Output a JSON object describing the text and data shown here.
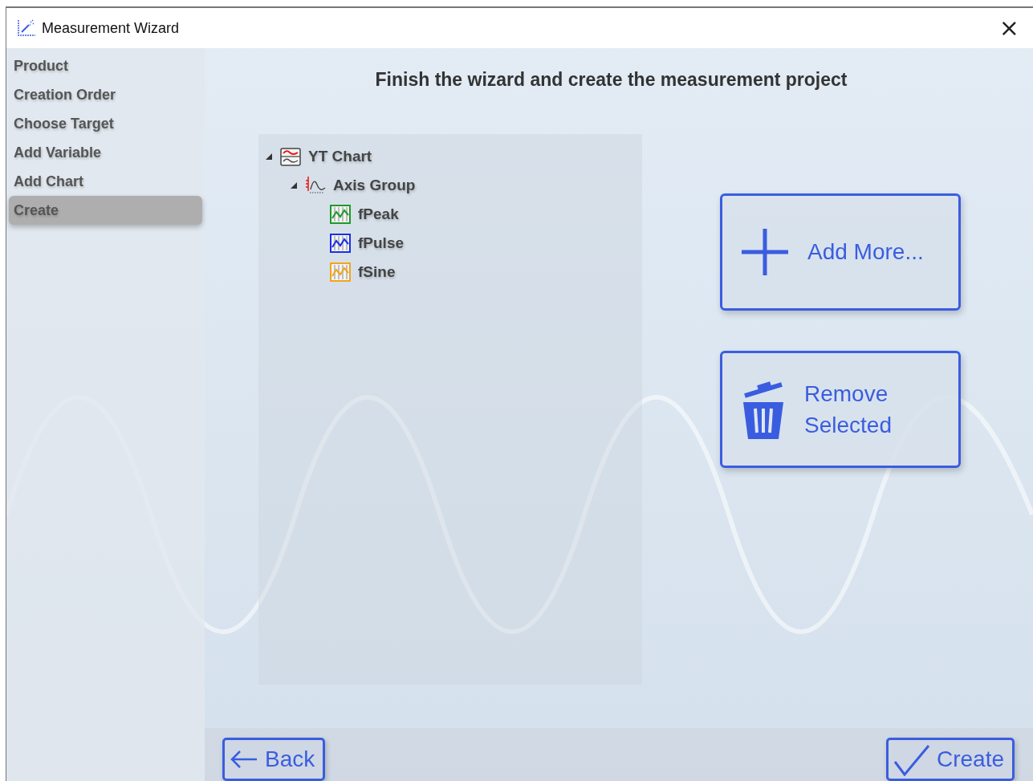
{
  "window": {
    "title": "Measurement Wizard",
    "close": "×"
  },
  "steps": [
    {
      "label": "Product",
      "selected": false
    },
    {
      "label": "Creation Order",
      "selected": false
    },
    {
      "label": "Choose Target",
      "selected": false
    },
    {
      "label": "Add Variable",
      "selected": false
    },
    {
      "label": "Add Chart",
      "selected": false
    },
    {
      "label": "Create",
      "selected": true
    }
  ],
  "heading": "Finish the wizard and create the measurement project",
  "tree": [
    {
      "label": "YT Chart",
      "kind": "chart",
      "expanded": true,
      "children": [
        {
          "label": "Axis Group",
          "kind": "axis-group",
          "expanded": true,
          "children": [
            {
              "label": "fPeak",
              "kind": "variable",
              "color": "#1e9a2a"
            },
            {
              "label": "fPulse",
              "kind": "variable",
              "color": "#1a2ee8"
            },
            {
              "label": "fSine",
              "kind": "variable",
              "color": "#f2a51a"
            }
          ]
        }
      ]
    }
  ],
  "actions": [
    {
      "label": "Add More...",
      "kind": "add"
    },
    {
      "label": "Remove Selected",
      "kind": "remove"
    }
  ],
  "nav": {
    "back": "Back",
    "create": "Create"
  }
}
